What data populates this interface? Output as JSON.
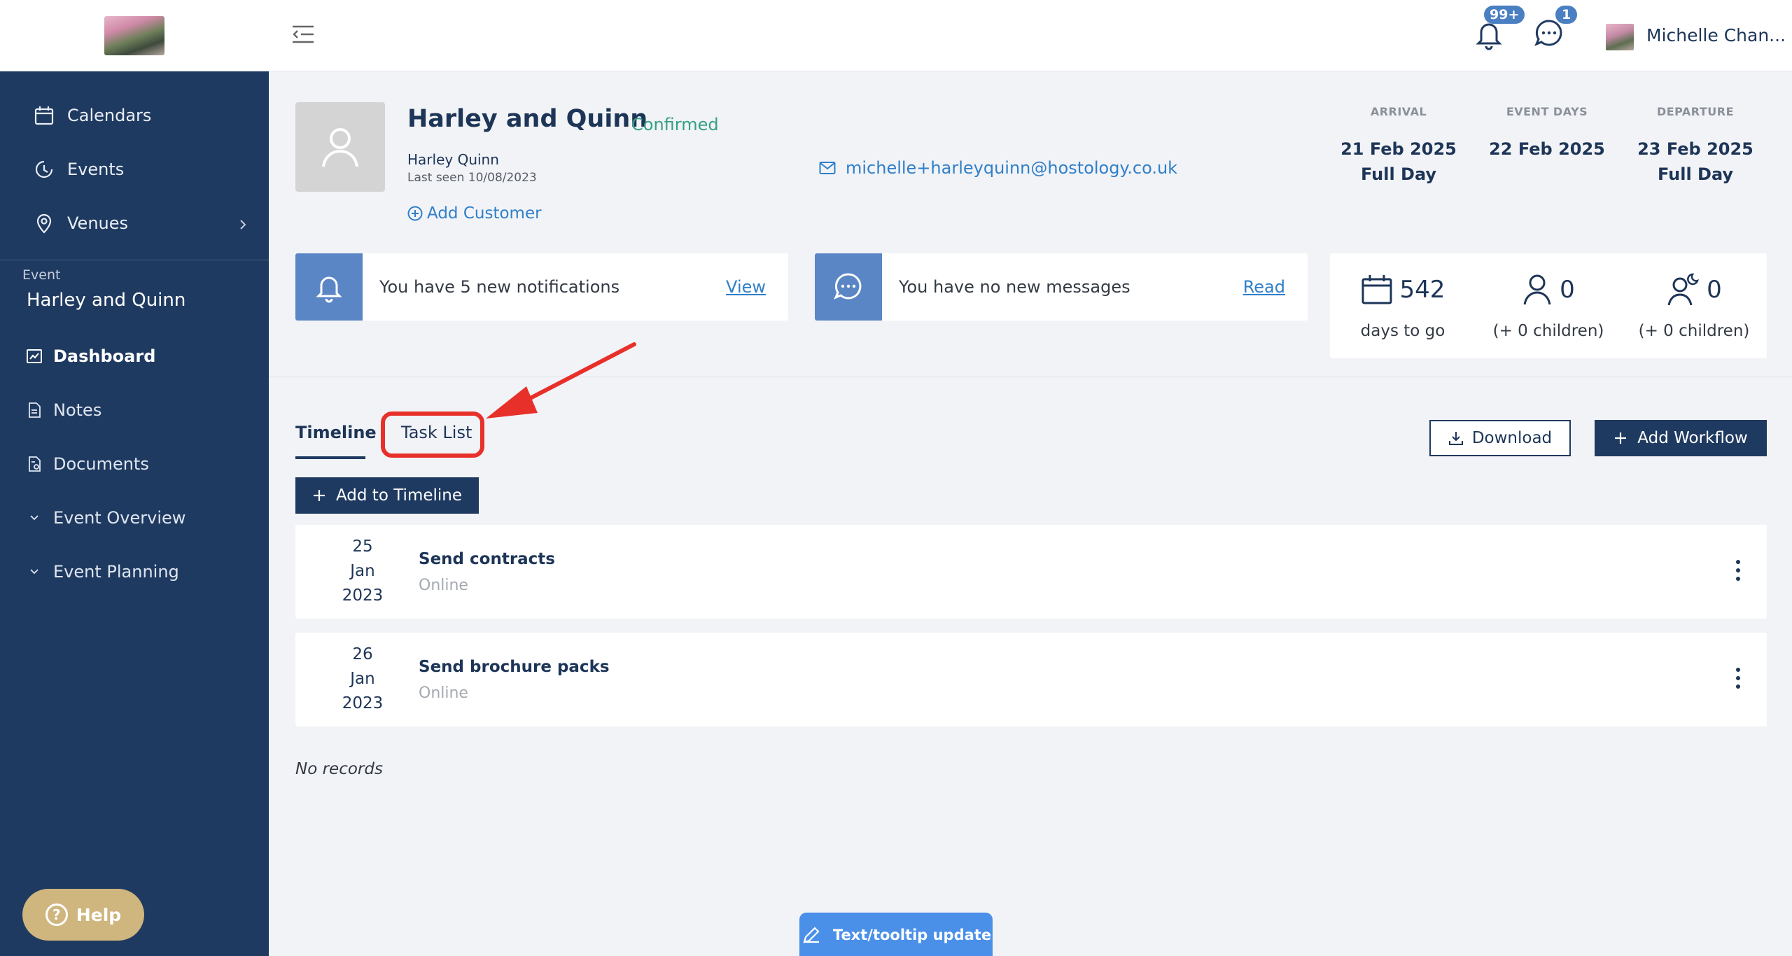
{
  "sidebar": {
    "nav": [
      {
        "label": "Calendars",
        "icon": "calendar-icon"
      },
      {
        "label": "Events",
        "icon": "events-icon"
      },
      {
        "label": "Venues",
        "icon": "location-pin-icon"
      }
    ],
    "section_label": "Event",
    "event_name": "Harley and Quinn",
    "sub_items": [
      {
        "label": "Dashboard",
        "icon": "chart-icon"
      },
      {
        "label": "Notes",
        "icon": "note-icon"
      },
      {
        "label": "Documents",
        "icon": "document-icon"
      },
      {
        "label": "Event Overview",
        "icon": "chevron-down-icon"
      },
      {
        "label": "Event Planning",
        "icon": "chevron-down-icon"
      }
    ],
    "help_label": "Help"
  },
  "topbar": {
    "notifications_badge": "99+",
    "messages_badge": "1",
    "user_name": "Michelle Chan..."
  },
  "header": {
    "title": "Harley and Quinn",
    "status": "Confirmed",
    "customer_name": "Harley Quinn",
    "last_seen": "Last seen 10/08/2023",
    "add_customer": "Add Customer",
    "email": "michelle+harleyquinn@hostology.co.uk",
    "arrival_label": "ARRIVAL",
    "arrival_date": "21 Feb 2025",
    "arrival_type": "Full Day",
    "event_days_label": "EVENT DAYS",
    "event_days_date": "22 Feb 2025",
    "departure_label": "DEPARTURE",
    "departure_date": "23 Feb 2025",
    "departure_type": "Full Day"
  },
  "cards": {
    "notifications_text": "You have 5 new notifications",
    "notifications_link": "View",
    "messages_text": "You have no new messages",
    "messages_link": "Read"
  },
  "stats": {
    "days": "542",
    "days_caption": "days to go",
    "adults": "0",
    "adults_caption": "(+ 0 children)",
    "night": "0",
    "night_caption": "(+ 0 children)"
  },
  "tabs": {
    "timeline": "Timeline",
    "task_list": "Task List"
  },
  "actions": {
    "download": "Download",
    "add_workflow": "Add Workflow",
    "add_timeline": "Add to Timeline"
  },
  "timeline": [
    {
      "day": "25",
      "month": "Jan",
      "year": "2023",
      "title": "Send contracts",
      "subtitle": "Online"
    },
    {
      "day": "26",
      "month": "Jan",
      "year": "2023",
      "title": "Send brochure packs",
      "subtitle": "Online"
    }
  ],
  "no_records": "No records",
  "tooltip_update": "Text/tooltip update",
  "colors": {
    "sidebar": "#1f3a60",
    "accent": "#5b86c5",
    "confirmed": "#35a084",
    "highlight": "#e8302a"
  }
}
